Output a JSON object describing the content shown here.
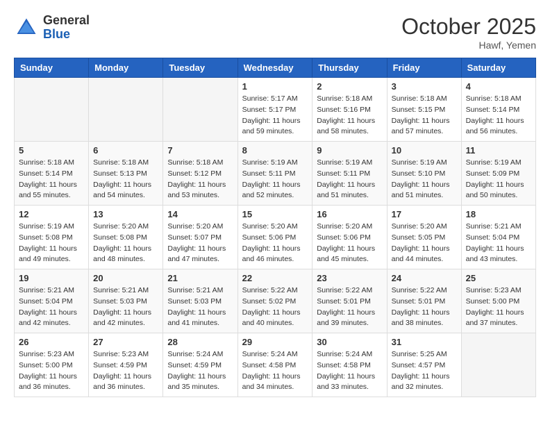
{
  "header": {
    "logo_general": "General",
    "logo_blue": "Blue",
    "month": "October 2025",
    "location": "Hawf, Yemen"
  },
  "weekdays": [
    "Sunday",
    "Monday",
    "Tuesday",
    "Wednesday",
    "Thursday",
    "Friday",
    "Saturday"
  ],
  "weeks": [
    [
      {
        "day": "",
        "sunrise": "",
        "sunset": "",
        "daylight": "",
        "empty": true
      },
      {
        "day": "",
        "sunrise": "",
        "sunset": "",
        "daylight": "",
        "empty": true
      },
      {
        "day": "",
        "sunrise": "",
        "sunset": "",
        "daylight": "",
        "empty": true
      },
      {
        "day": "1",
        "sunrise": "Sunrise: 5:17 AM",
        "sunset": "Sunset: 5:17 PM",
        "daylight": "Daylight: 11 hours and 59 minutes."
      },
      {
        "day": "2",
        "sunrise": "Sunrise: 5:18 AM",
        "sunset": "Sunset: 5:16 PM",
        "daylight": "Daylight: 11 hours and 58 minutes."
      },
      {
        "day": "3",
        "sunrise": "Sunrise: 5:18 AM",
        "sunset": "Sunset: 5:15 PM",
        "daylight": "Daylight: 11 hours and 57 minutes."
      },
      {
        "day": "4",
        "sunrise": "Sunrise: 5:18 AM",
        "sunset": "Sunset: 5:14 PM",
        "daylight": "Daylight: 11 hours and 56 minutes."
      }
    ],
    [
      {
        "day": "5",
        "sunrise": "Sunrise: 5:18 AM",
        "sunset": "Sunset: 5:14 PM",
        "daylight": "Daylight: 11 hours and 55 minutes."
      },
      {
        "day": "6",
        "sunrise": "Sunrise: 5:18 AM",
        "sunset": "Sunset: 5:13 PM",
        "daylight": "Daylight: 11 hours and 54 minutes."
      },
      {
        "day": "7",
        "sunrise": "Sunrise: 5:18 AM",
        "sunset": "Sunset: 5:12 PM",
        "daylight": "Daylight: 11 hours and 53 minutes."
      },
      {
        "day": "8",
        "sunrise": "Sunrise: 5:19 AM",
        "sunset": "Sunset: 5:11 PM",
        "daylight": "Daylight: 11 hours and 52 minutes."
      },
      {
        "day": "9",
        "sunrise": "Sunrise: 5:19 AM",
        "sunset": "Sunset: 5:11 PM",
        "daylight": "Daylight: 11 hours and 51 minutes."
      },
      {
        "day": "10",
        "sunrise": "Sunrise: 5:19 AM",
        "sunset": "Sunset: 5:10 PM",
        "daylight": "Daylight: 11 hours and 51 minutes."
      },
      {
        "day": "11",
        "sunrise": "Sunrise: 5:19 AM",
        "sunset": "Sunset: 5:09 PM",
        "daylight": "Daylight: 11 hours and 50 minutes."
      }
    ],
    [
      {
        "day": "12",
        "sunrise": "Sunrise: 5:19 AM",
        "sunset": "Sunset: 5:08 PM",
        "daylight": "Daylight: 11 hours and 49 minutes."
      },
      {
        "day": "13",
        "sunrise": "Sunrise: 5:20 AM",
        "sunset": "Sunset: 5:08 PM",
        "daylight": "Daylight: 11 hours and 48 minutes."
      },
      {
        "day": "14",
        "sunrise": "Sunrise: 5:20 AM",
        "sunset": "Sunset: 5:07 PM",
        "daylight": "Daylight: 11 hours and 47 minutes."
      },
      {
        "day": "15",
        "sunrise": "Sunrise: 5:20 AM",
        "sunset": "Sunset: 5:06 PM",
        "daylight": "Daylight: 11 hours and 46 minutes."
      },
      {
        "day": "16",
        "sunrise": "Sunrise: 5:20 AM",
        "sunset": "Sunset: 5:06 PM",
        "daylight": "Daylight: 11 hours and 45 minutes."
      },
      {
        "day": "17",
        "sunrise": "Sunrise: 5:20 AM",
        "sunset": "Sunset: 5:05 PM",
        "daylight": "Daylight: 11 hours and 44 minutes."
      },
      {
        "day": "18",
        "sunrise": "Sunrise: 5:21 AM",
        "sunset": "Sunset: 5:04 PM",
        "daylight": "Daylight: 11 hours and 43 minutes."
      }
    ],
    [
      {
        "day": "19",
        "sunrise": "Sunrise: 5:21 AM",
        "sunset": "Sunset: 5:04 PM",
        "daylight": "Daylight: 11 hours and 42 minutes."
      },
      {
        "day": "20",
        "sunrise": "Sunrise: 5:21 AM",
        "sunset": "Sunset: 5:03 PM",
        "daylight": "Daylight: 11 hours and 42 minutes."
      },
      {
        "day": "21",
        "sunrise": "Sunrise: 5:21 AM",
        "sunset": "Sunset: 5:03 PM",
        "daylight": "Daylight: 11 hours and 41 minutes."
      },
      {
        "day": "22",
        "sunrise": "Sunrise: 5:22 AM",
        "sunset": "Sunset: 5:02 PM",
        "daylight": "Daylight: 11 hours and 40 minutes."
      },
      {
        "day": "23",
        "sunrise": "Sunrise: 5:22 AM",
        "sunset": "Sunset: 5:01 PM",
        "daylight": "Daylight: 11 hours and 39 minutes."
      },
      {
        "day": "24",
        "sunrise": "Sunrise: 5:22 AM",
        "sunset": "Sunset: 5:01 PM",
        "daylight": "Daylight: 11 hours and 38 minutes."
      },
      {
        "day": "25",
        "sunrise": "Sunrise: 5:23 AM",
        "sunset": "Sunset: 5:00 PM",
        "daylight": "Daylight: 11 hours and 37 minutes."
      }
    ],
    [
      {
        "day": "26",
        "sunrise": "Sunrise: 5:23 AM",
        "sunset": "Sunset: 5:00 PM",
        "daylight": "Daylight: 11 hours and 36 minutes."
      },
      {
        "day": "27",
        "sunrise": "Sunrise: 5:23 AM",
        "sunset": "Sunset: 4:59 PM",
        "daylight": "Daylight: 11 hours and 36 minutes."
      },
      {
        "day": "28",
        "sunrise": "Sunrise: 5:24 AM",
        "sunset": "Sunset: 4:59 PM",
        "daylight": "Daylight: 11 hours and 35 minutes."
      },
      {
        "day": "29",
        "sunrise": "Sunrise: 5:24 AM",
        "sunset": "Sunset: 4:58 PM",
        "daylight": "Daylight: 11 hours and 34 minutes."
      },
      {
        "day": "30",
        "sunrise": "Sunrise: 5:24 AM",
        "sunset": "Sunset: 4:58 PM",
        "daylight": "Daylight: 11 hours and 33 minutes."
      },
      {
        "day": "31",
        "sunrise": "Sunrise: 5:25 AM",
        "sunset": "Sunset: 4:57 PM",
        "daylight": "Daylight: 11 hours and 32 minutes."
      },
      {
        "day": "",
        "sunrise": "",
        "sunset": "",
        "daylight": "",
        "empty": true
      }
    ]
  ]
}
